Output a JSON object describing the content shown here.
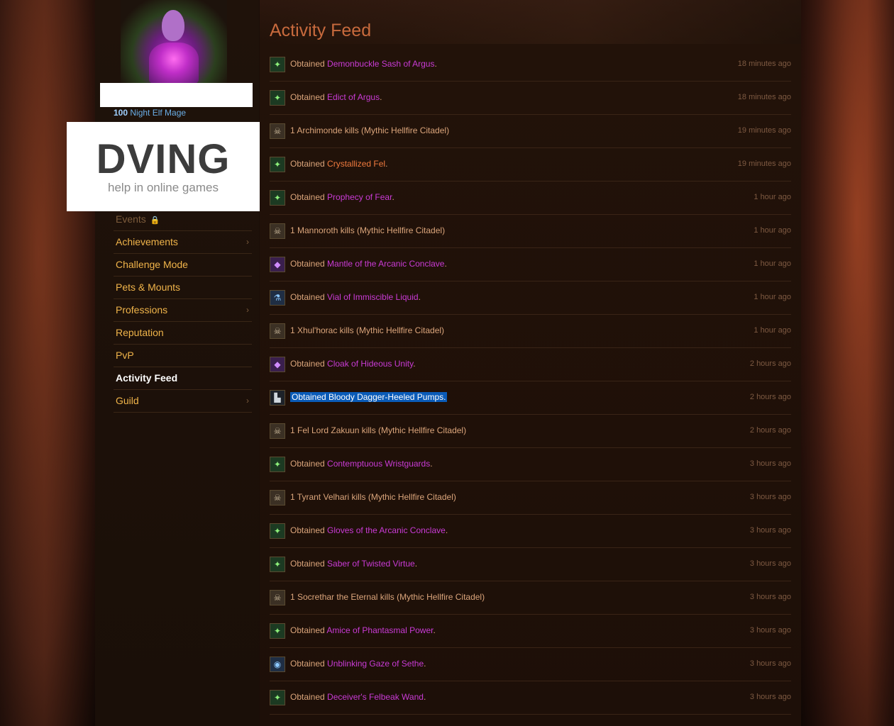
{
  "character": {
    "level": "100",
    "race_class": "Night Elf Mage"
  },
  "watermark": {
    "title": "DVING",
    "subtitle": "help in online games"
  },
  "nav": [
    {
      "label": "Events",
      "locked": true,
      "chevron": false
    },
    {
      "label": "Achievements",
      "chevron": true
    },
    {
      "label": "Challenge Mode",
      "chevron": false
    },
    {
      "label": "Pets & Mounts",
      "chevron": false
    },
    {
      "label": "Professions",
      "chevron": true
    },
    {
      "label": "Reputation",
      "chevron": false
    },
    {
      "label": "PvP",
      "chevron": false
    },
    {
      "label": "Activity Feed",
      "active": true,
      "chevron": false
    },
    {
      "label": "Guild",
      "chevron": true
    }
  ],
  "page_title": "Activity Feed",
  "feed": [
    {
      "prefix": "Obtained ",
      "item": "Demonbuckle Sash of Argus",
      "suffix": ".",
      "time": "18 minutes ago"
    },
    {
      "prefix": "Obtained ",
      "item": "Edict of Argus",
      "suffix": ".",
      "time": "18 minutes ago"
    },
    {
      "prefix": "1 Archimonde kills (Mythic Hellfire Citadel)",
      "item": "",
      "suffix": "",
      "time": "19 minutes ago"
    },
    {
      "prefix": "Obtained ",
      "item": "Crystallized Fel",
      "suffix": ".",
      "time": "19 minutes ago"
    },
    {
      "prefix": "Obtained ",
      "item": "Prophecy of Fear",
      "suffix": ".",
      "time": "1 hour ago"
    },
    {
      "prefix": "1 Mannoroth kills (Mythic Hellfire Citadel)",
      "item": "",
      "suffix": "",
      "time": "1 hour ago"
    },
    {
      "prefix": "Obtained ",
      "item": "Mantle of the Arcanic Conclave",
      "suffix": ".",
      "time": "1 hour ago"
    },
    {
      "prefix": "Obtained ",
      "item": "Vial of Immiscible Liquid",
      "suffix": ".",
      "time": "1 hour ago"
    },
    {
      "prefix": "1 Xhul'horac kills (Mythic Hellfire Citadel)",
      "item": "",
      "suffix": "",
      "time": "1 hour ago"
    },
    {
      "prefix": "Obtained ",
      "item": "Cloak of Hideous Unity",
      "suffix": ".",
      "time": "2 hours ago"
    },
    {
      "prefix": "Obtained ",
      "item": "Bloody Dagger-Heeled Pumps",
      "suffix": ".",
      "time": "2 hours ago"
    },
    {
      "prefix": "1 Fel Lord Zakuun kills (Mythic Hellfire Citadel)",
      "item": "",
      "suffix": "",
      "time": "2 hours ago"
    },
    {
      "prefix": "Obtained ",
      "item": "Contemptuous Wristguards",
      "suffix": ".",
      "time": "3 hours ago"
    },
    {
      "prefix": "1 Tyrant Velhari kills (Mythic Hellfire Citadel)",
      "item": "",
      "suffix": "",
      "time": "3 hours ago"
    },
    {
      "prefix": "Obtained ",
      "item": "Gloves of the Arcanic Conclave",
      "suffix": ".",
      "time": "3 hours ago"
    },
    {
      "prefix": "Obtained ",
      "item": "Saber of Twisted Virtue",
      "suffix": ".",
      "time": "3 hours ago"
    },
    {
      "prefix": "1 Socrethar the Eternal kills (Mythic Hellfire Citadel)",
      "item": "",
      "suffix": "",
      "time": "3 hours ago"
    },
    {
      "prefix": "Obtained ",
      "item": "Amice of Phantasmal Power",
      "suffix": ".",
      "time": "3 hours ago"
    },
    {
      "prefix": "Obtained ",
      "item": "Unblinking Gaze of Sethe",
      "suffix": ".",
      "time": "3 hours ago"
    },
    {
      "prefix": "Obtained ",
      "item": "Deceiver's Felbeak Wand",
      "suffix": ".",
      "time": "3 hours ago"
    }
  ],
  "colors": {
    "epic": "#c93bd5",
    "legendary": "#ef7a3e",
    "nav_text": "#f0b44a",
    "title": "#c86a3d",
    "selection": "#0a5bb8"
  }
}
